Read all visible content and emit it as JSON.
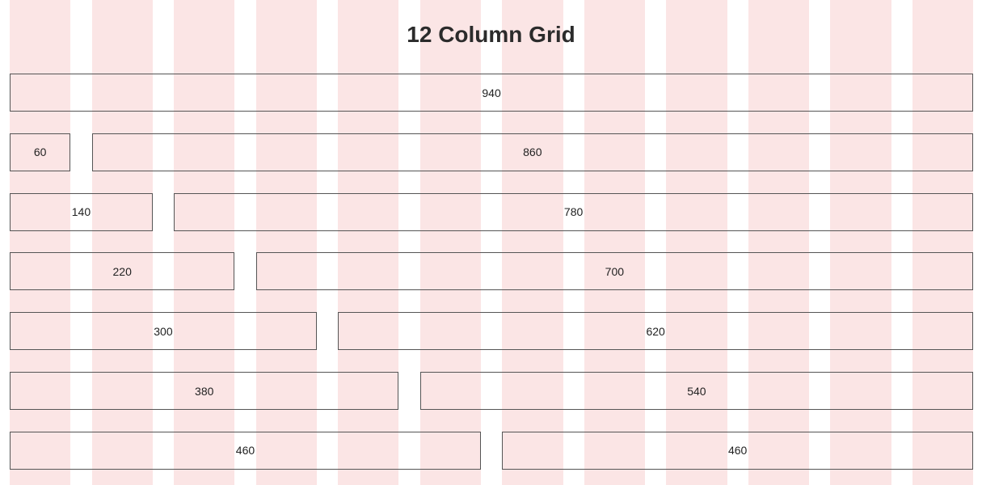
{
  "title": "12 Column Grid",
  "colors": {
    "column_fill": "#fbe5e5",
    "box_border": "#555555",
    "title_text": "#2b2b2b"
  },
  "grid": {
    "columns": 12,
    "rows": [
      {
        "cells": [
          {
            "label": "940",
            "span": 12
          }
        ]
      },
      {
        "cells": [
          {
            "label": "60",
            "span": 1
          },
          {
            "label": "860",
            "span": 11
          }
        ]
      },
      {
        "cells": [
          {
            "label": "140",
            "span": 2
          },
          {
            "label": "780",
            "span": 10
          }
        ]
      },
      {
        "cells": [
          {
            "label": "220",
            "span": 3
          },
          {
            "label": "700",
            "span": 9
          }
        ]
      },
      {
        "cells": [
          {
            "label": "300",
            "span": 4
          },
          {
            "label": "620",
            "span": 8
          }
        ]
      },
      {
        "cells": [
          {
            "label": "380",
            "span": 5
          },
          {
            "label": "540",
            "span": 7
          }
        ]
      },
      {
        "cells": [
          {
            "label": "460",
            "span": 6
          },
          {
            "label": "460",
            "span": 6
          }
        ]
      }
    ]
  }
}
